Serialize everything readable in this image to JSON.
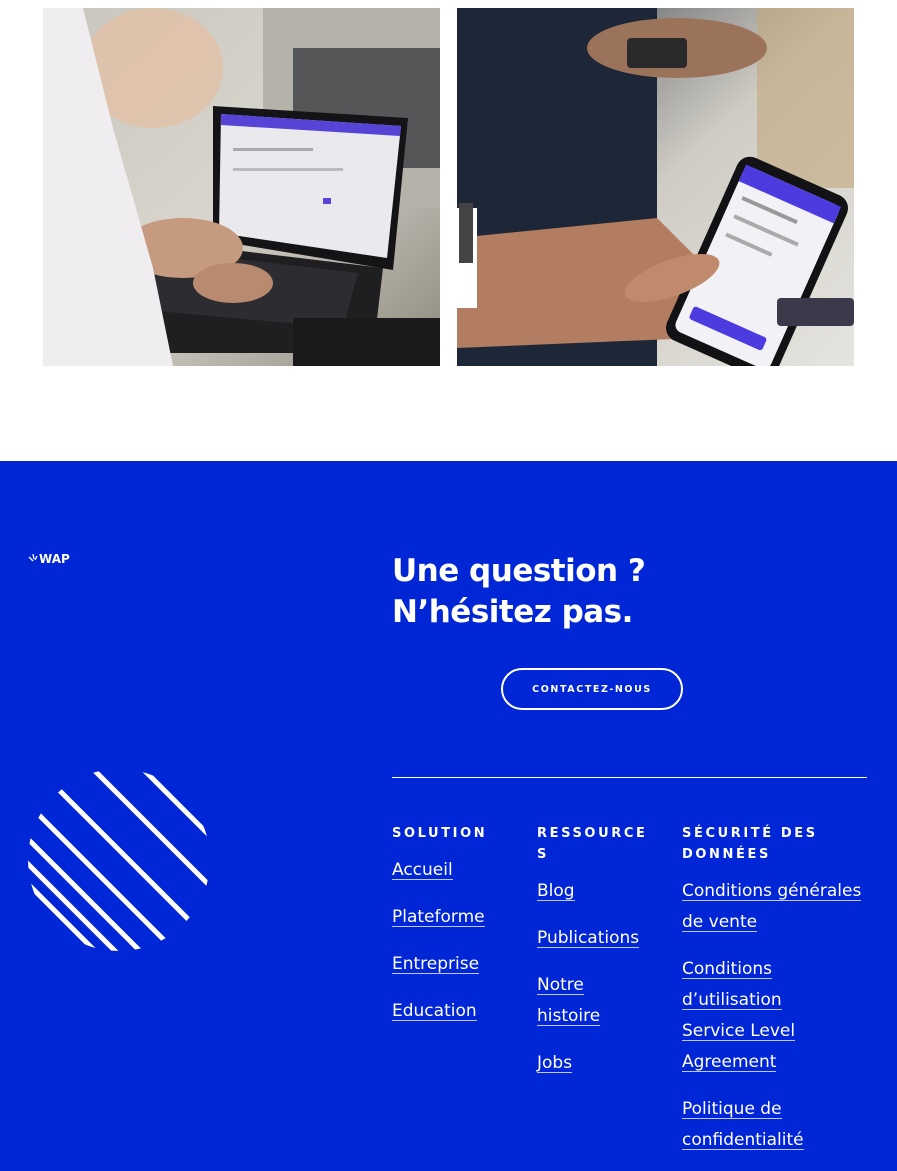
{
  "photos": {
    "left_alt": "person typing on laptop",
    "right_alt": "hand holding smartphone"
  },
  "footer": {
    "logo_text": "WAP",
    "headline_line1": "Une question ?",
    "headline_line2": "N’hésitez pas.",
    "cta_label": "CONTACTEZ-NOUS",
    "columns": {
      "solution": {
        "title": "SOLUTION",
        "links": [
          "Accueil",
          "Plateforme",
          "Entreprise",
          "Education"
        ]
      },
      "resources": {
        "title": "RESSOURCE S",
        "links": [
          "Blog",
          "Publications",
          "Notre histoire",
          "Jobs"
        ]
      },
      "security": {
        "title": "SÉCURITÉ DES DONNÉES",
        "links": [
          "Conditions générales de vente",
          "Conditions d’utilisation",
          "Service Level Agreement",
          "Politique de confidentialité"
        ]
      }
    }
  },
  "colors": {
    "footer_bg": "#0026d6",
    "text": "#ffffff",
    "accent_purple": "#4c3ce0"
  }
}
